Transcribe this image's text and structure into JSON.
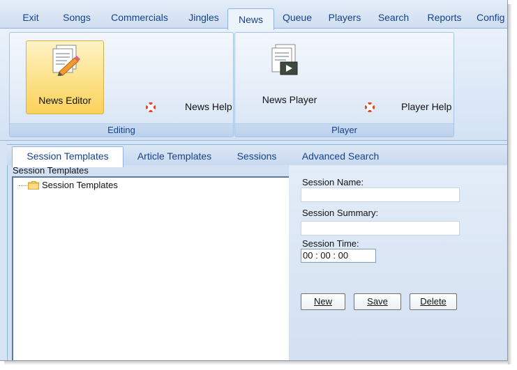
{
  "ribbon_tabs": [
    {
      "label": "Exit"
    },
    {
      "label": "Songs"
    },
    {
      "label": "Commercials"
    },
    {
      "label": "Jingles"
    },
    {
      "label": "News"
    },
    {
      "label": "Queue"
    },
    {
      "label": "Players"
    },
    {
      "label": "Search"
    },
    {
      "label": "Reports"
    },
    {
      "label": "Config"
    }
  ],
  "active_ribbon_tab": "News",
  "ribbon": {
    "editing": {
      "group_label": "Editing",
      "news_editor_label": "News Editor",
      "news_help_label": "News Help"
    },
    "player": {
      "group_label": "Player",
      "news_player_label": "News Player",
      "player_help_label": "Player Help"
    }
  },
  "lower_tabs": [
    {
      "label": "Session Templates"
    },
    {
      "label": "Article Templates"
    },
    {
      "label": "Sessions"
    },
    {
      "label": "Advanced Search"
    }
  ],
  "active_lower_tab": "Session Templates",
  "tree": {
    "title": "Session Templates",
    "root_label": "Session Templates"
  },
  "form": {
    "session_name_label": "Session Name:",
    "session_name_value": "",
    "session_summary_label": "Session Summary:",
    "session_summary_value": "",
    "session_time_label": "Session Time:",
    "session_time_value": "00 : 00 : 00",
    "new_label": "New",
    "save_label": "Save",
    "delete_label": "Delete"
  },
  "colors": {
    "accent_text": "#15428b",
    "selected_button": "#fbd15a",
    "ribbon_border": "#8db2e3"
  }
}
